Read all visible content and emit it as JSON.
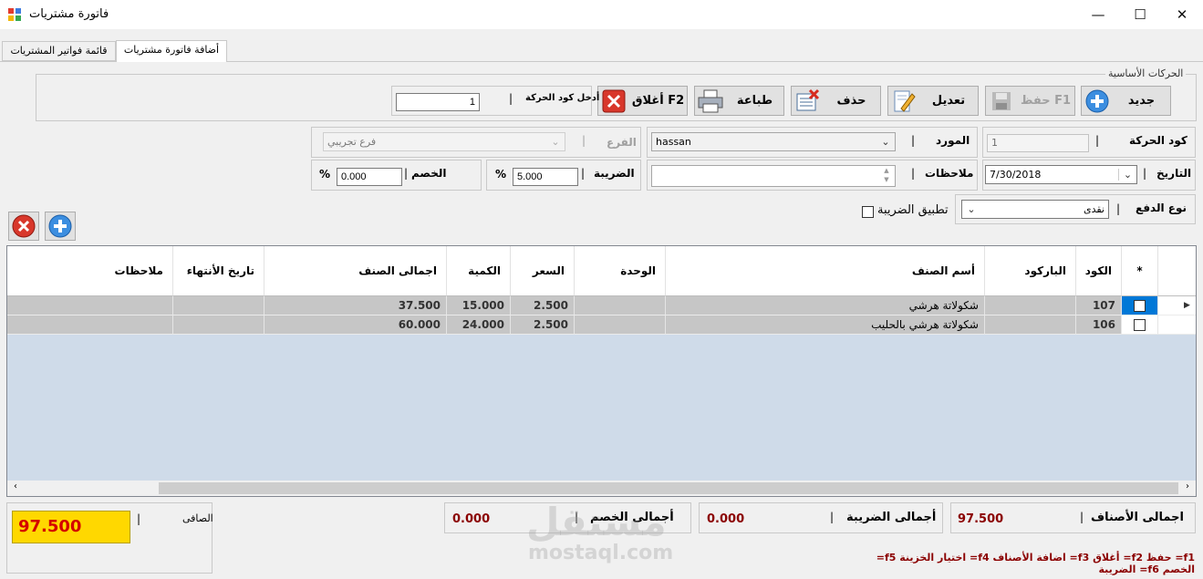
{
  "window": {
    "title": "فاتورة مشتريات",
    "minimize": "—",
    "maximize": "☐",
    "close": "✕"
  },
  "tabs": [
    {
      "label": "أضافة فاتورة مشتريات",
      "active": true
    },
    {
      "label": "قائمة فواتير المشتريات",
      "active": false
    }
  ],
  "actions": {
    "group_label": "الحركات الأساسية",
    "new_label": "جديد",
    "save_label": "حفظ F1",
    "edit_label": "تعديل",
    "delete_label": "حذف",
    "print_label": "طباعة",
    "close_label": "أغلاق F2",
    "code_entry_label": "أدخل كود الحركة",
    "code_entry_sep": "|",
    "code_entry_value": "1"
  },
  "form": {
    "code_label": "كود الحركة",
    "code_value": "1",
    "supplier_label": "المورد",
    "supplier_value": "hassan",
    "branch_label": "الفرع",
    "branch_value": "فرع تجريبي",
    "date_label": "التاريخ",
    "date_value": "7/30/2018",
    "notes_label": "ملاحظات",
    "notes_value": "",
    "tax_label": "الضريبة",
    "tax_value": "5.000",
    "discount_label": "الخصم",
    "discount_value": "0.000",
    "percent": "%",
    "sep": "|",
    "payment_label": "نوع الدفع",
    "payment_value": "نقدى",
    "apply_tax_label": "تطبيق الضريبة"
  },
  "grid": {
    "headers": {
      "star": "*",
      "code": "الكود",
      "barcode": "الباركود",
      "name": "أسم الصنف",
      "unit": "الوحدة",
      "price": "السعر",
      "qty": "الكمية",
      "total": "اجمالى الصنف",
      "expiry": "تاريخ الأنتهاء",
      "notes": "ملاحظات"
    },
    "rows": [
      {
        "code": "107",
        "barcode": "",
        "name": "شكولاتة هرشي",
        "unit": "",
        "price": "2.500",
        "qty": "15.000",
        "total": "37.500",
        "expiry": "",
        "notes": ""
      },
      {
        "code": "106",
        "barcode": "",
        "name": "شكولاتة هرشي بالحليب",
        "unit": "",
        "price": "2.500",
        "qty": "24.000",
        "total": "60.000",
        "expiry": "",
        "notes": ""
      }
    ]
  },
  "totals": {
    "items_label": "اجمالى الأصناف",
    "items_value": "97.500",
    "tax_label": "أجمالى الضريبة",
    "tax_value": "0.000",
    "discount_label": "أجمالى الخصم",
    "discount_value": "0.000",
    "net_label": "الصافى",
    "net_value": "97.500",
    "sep": "|"
  },
  "shortcuts": "f1= حفظ  f2= أغلاق  f3= اضافة الأصناف  f4= اختيار الخزينة  f5= الخصم  f6= الضريبة",
  "watermark": {
    "arabic": "مستقل",
    "latin": "mostaql.com"
  },
  "colors": {
    "net_bg": "#ffd800",
    "net_fg": "#d40000",
    "totals_fg": "#8b0000",
    "selected": "#0078d7"
  }
}
